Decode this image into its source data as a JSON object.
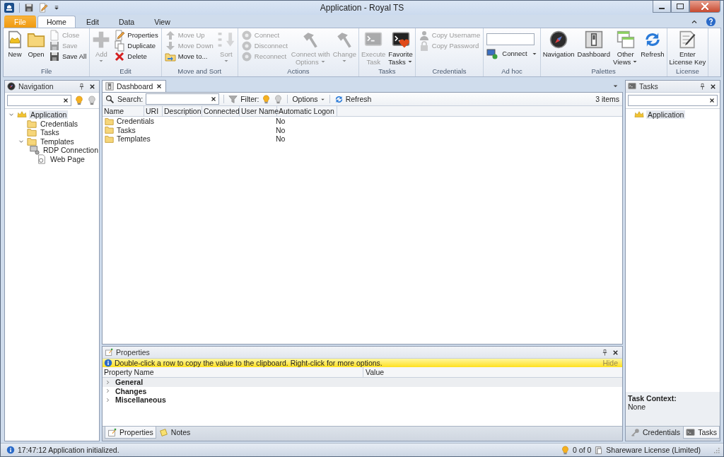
{
  "window": {
    "title": "Application - Royal TS"
  },
  "ribbon": {
    "tabs": [
      {
        "label": "File",
        "kind": "menu",
        "selected": false
      },
      {
        "label": "Home",
        "kind": "tab",
        "selected": true
      },
      {
        "label": "Edit",
        "kind": "tab",
        "selected": false
      },
      {
        "label": "Data",
        "kind": "tab",
        "selected": false
      },
      {
        "label": "View",
        "kind": "tab",
        "selected": false
      }
    ],
    "groups": [
      {
        "label": "File",
        "columns": [
          {
            "kind": "large",
            "lines": [
              "New"
            ],
            "disabled": false,
            "dropdown": false
          },
          {
            "kind": "large",
            "lines": [
              "Open"
            ],
            "disabled": false,
            "dropdown": false
          },
          {
            "kind": "stack",
            "items": [
              {
                "kind": "button",
                "label": "Close",
                "disabled": true
              },
              {
                "kind": "button",
                "label": "Save",
                "disabled": true
              },
              {
                "kind": "button",
                "label": "Save All",
                "disabled": false
              }
            ]
          }
        ]
      },
      {
        "label": "Edit",
        "columns": [
          {
            "kind": "large",
            "lines": [
              "Add"
            ],
            "disabled": true,
            "dropdown": true
          },
          {
            "kind": "stack",
            "items": [
              {
                "kind": "button",
                "label": "Properties",
                "disabled": false
              },
              {
                "kind": "button",
                "label": "Duplicate",
                "disabled": false
              },
              {
                "kind": "button",
                "label": "Delete",
                "disabled": false
              }
            ]
          }
        ]
      },
      {
        "label": "Move and Sort",
        "columns": [
          {
            "kind": "stack",
            "items": [
              {
                "kind": "button",
                "label": "Move Up",
                "disabled": true
              },
              {
                "kind": "button",
                "label": "Move Down",
                "disabled": true
              },
              {
                "kind": "button",
                "label": "Move to...",
                "disabled": false
              }
            ]
          },
          {
            "kind": "large",
            "lines": [
              "Sort"
            ],
            "disabled": true,
            "dropdown": true
          }
        ]
      },
      {
        "label": "Actions",
        "columns": [
          {
            "kind": "stack",
            "items": [
              {
                "kind": "button",
                "label": "Connect",
                "disabled": true
              },
              {
                "kind": "button",
                "label": "Disconnect",
                "disabled": true
              },
              {
                "kind": "button",
                "label": "Reconnect",
                "disabled": true
              }
            ]
          },
          {
            "kind": "large",
            "lines": [
              "Connect with",
              "Options"
            ],
            "disabled": true,
            "dropdown": true
          },
          {
            "kind": "large",
            "lines": [
              "Change"
            ],
            "disabled": true,
            "dropdown": true
          }
        ]
      },
      {
        "label": "Tasks",
        "columns": [
          {
            "kind": "large",
            "lines": [
              "Execute",
              "Task"
            ],
            "disabled": true,
            "dropdown": false
          },
          {
            "kind": "large",
            "lines": [
              "Favorite",
              "Tasks"
            ],
            "disabled": false,
            "dropdown": true
          }
        ]
      },
      {
        "label": "Credentials",
        "columns": [
          {
            "kind": "stack",
            "items": [
              {
                "kind": "button",
                "label": "Copy Username",
                "disabled": true
              },
              {
                "kind": "button",
                "label": "Copy Password",
                "disabled": true
              }
            ]
          }
        ]
      },
      {
        "label": "Ad hoc",
        "columns": [
          {
            "kind": "stack",
            "items": [
              {
                "kind": "field"
              },
              {
                "kind": "split-button",
                "label": "Connect",
                "disabled": false
              }
            ]
          }
        ]
      },
      {
        "label": "Palettes",
        "columns": [
          {
            "kind": "large",
            "lines": [
              "Navigation"
            ],
            "disabled": false,
            "dropdown": false
          },
          {
            "kind": "large",
            "lines": [
              "Dashboard"
            ],
            "disabled": false,
            "dropdown": false
          },
          {
            "kind": "large",
            "lines": [
              "Other",
              "Views"
            ],
            "disabled": false,
            "dropdown": true
          },
          {
            "kind": "large",
            "lines": [
              "Refresh"
            ],
            "disabled": false,
            "dropdown": false
          }
        ]
      },
      {
        "label": "License",
        "columns": [
          {
            "kind": "large",
            "lines": [
              "Enter",
              "License Key"
            ],
            "disabled": false,
            "dropdown": false
          }
        ]
      }
    ]
  },
  "navigation": {
    "title": "Navigation",
    "tree": [
      {
        "label": "Application",
        "kind": "application",
        "selected": true,
        "expanded": true,
        "children": [
          {
            "label": "Credentials",
            "kind": "folder",
            "selected": false
          },
          {
            "label": "Tasks",
            "kind": "folder",
            "selected": false
          },
          {
            "label": "Templates",
            "kind": "folder",
            "selected": false,
            "expanded": true,
            "children": [
              {
                "label": "RDP Connection",
                "kind": "connection",
                "selected": false
              },
              {
                "label": "Web Page",
                "kind": "web-page",
                "selected": false
              }
            ]
          }
        ]
      }
    ]
  },
  "dashboard": {
    "tab": "Dashboard",
    "toolbar": {
      "search_label": "Search:",
      "filter_label": "Filter:",
      "options": "Options",
      "refresh": "Refresh",
      "count": "3 items"
    },
    "columns": [
      "Name",
      "URI",
      "Description",
      "Connected",
      "User Name",
      "Automatic Logon"
    ],
    "rows": [
      {
        "name": "Credentials",
        "automatic_logon": "No"
      },
      {
        "name": "Tasks",
        "automatic_logon": "No"
      },
      {
        "name": "Templates",
        "automatic_logon": "No"
      }
    ]
  },
  "properties": {
    "title": "Properties",
    "info": "Double-click a row to copy the value to the clipboard. Right-click for more options.",
    "hide": "Hide",
    "columns": [
      "Property Name",
      "Value"
    ],
    "categories": [
      {
        "label": "General",
        "selected": true,
        "expanded": false
      },
      {
        "label": "Changes",
        "selected": false,
        "expanded": false
      },
      {
        "label": "Miscellaneous",
        "selected": false,
        "expanded": false
      }
    ],
    "tabs": [
      {
        "label": "Properties",
        "selected": true
      },
      {
        "label": "Notes",
        "selected": false
      }
    ]
  },
  "tasks": {
    "title": "Tasks",
    "tree": [
      {
        "label": "Application",
        "selected": true
      }
    ],
    "context_label": "Task Context:",
    "context_value": "None",
    "tabs": [
      {
        "label": "Credentials",
        "selected": false
      },
      {
        "label": "Tasks",
        "selected": true
      }
    ]
  },
  "status_bar": {
    "message": "17:47:12 Application initialized.",
    "count": "0 of 0",
    "license": "Shareware License (Limited)"
  }
}
